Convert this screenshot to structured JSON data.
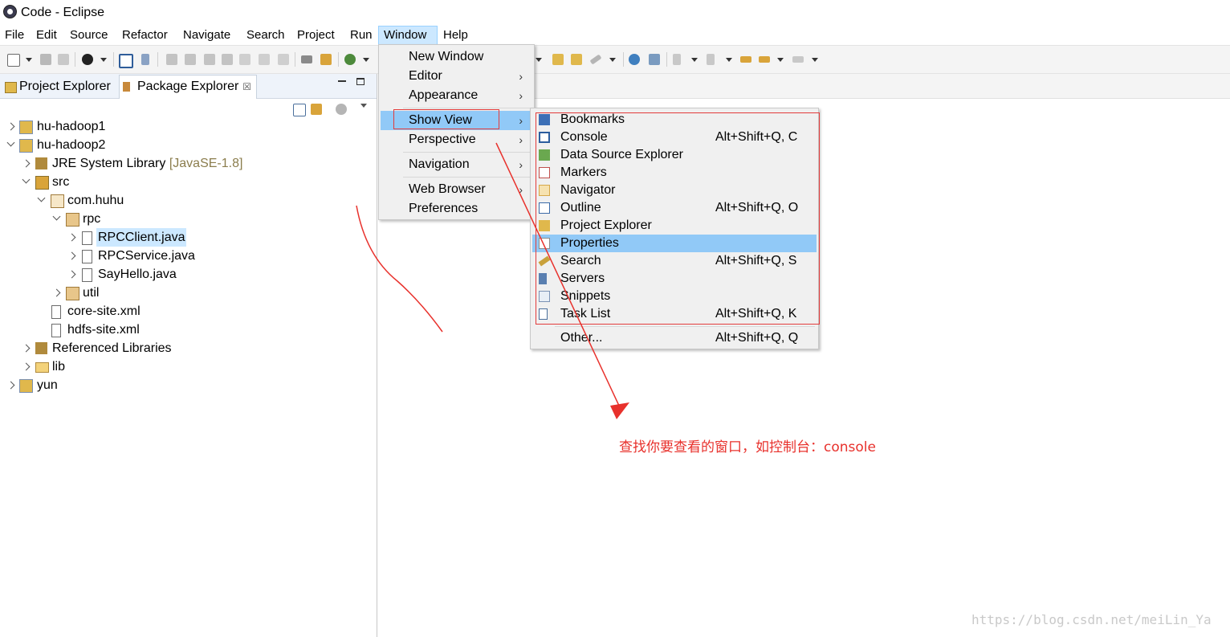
{
  "window": {
    "title": "Code - Eclipse",
    "icon": "eclipse-icon"
  },
  "menubar": {
    "items": [
      {
        "label": "File"
      },
      {
        "label": "Edit"
      },
      {
        "label": "Source"
      },
      {
        "label": "Refactor"
      },
      {
        "label": "Navigate"
      },
      {
        "label": "Search"
      },
      {
        "label": "Project"
      },
      {
        "label": "Run"
      },
      {
        "label": "Window"
      },
      {
        "label": "Help"
      }
    ],
    "active": "Window"
  },
  "left_view": {
    "tabs": [
      {
        "label": "Project Explorer",
        "icon": "project-explorer-icon"
      },
      {
        "label": "Package Explorer",
        "icon": "package-explorer-icon",
        "close": "☒"
      }
    ],
    "tree": [
      {
        "label": "hu-hadoop1",
        "icon": "project-icon"
      },
      {
        "label": "hu-hadoop2",
        "icon": "project-icon"
      },
      {
        "label": "JRE System Library",
        "decoration": "[JavaSE-1.8]",
        "icon": "library-icon"
      },
      {
        "label": "src",
        "icon": "source-folder-icon"
      },
      {
        "label": "com.huhu",
        "icon": "package-icon"
      },
      {
        "label": "rpc",
        "icon": "package-icon"
      },
      {
        "label": "RPCClient.java",
        "icon": "java-file-icon"
      },
      {
        "label": "RPCService.java",
        "icon": "java-file-icon"
      },
      {
        "label": "SayHello.java",
        "icon": "java-file-icon"
      },
      {
        "label": "util",
        "icon": "package-icon"
      },
      {
        "label": "core-site.xml",
        "icon": "xml-file-icon"
      },
      {
        "label": "hdfs-site.xml",
        "icon": "xml-file-icon"
      },
      {
        "label": "Referenced Libraries",
        "icon": "library-icon"
      },
      {
        "label": "lib",
        "icon": "folder-icon"
      },
      {
        "label": "yun",
        "icon": "project-icon"
      }
    ]
  },
  "window_menu": {
    "items": [
      {
        "label": "New Window"
      },
      {
        "label": "Editor",
        "arrow": "›"
      },
      {
        "label": "Appearance",
        "arrow": "›"
      },
      {
        "label": "Show View",
        "arrow": "›"
      },
      {
        "label": "Perspective",
        "arrow": "›"
      },
      {
        "label": "Navigation",
        "arrow": "›"
      },
      {
        "label": "Web Browser",
        "arrow": "›"
      },
      {
        "label": "Preferences"
      }
    ],
    "highlighted": "Show View"
  },
  "show_view_menu": {
    "items": [
      {
        "label": "Bookmarks",
        "shortcut": "",
        "icon": "bookmarks-icon",
        "color": "#3c6fb6"
      },
      {
        "label": "Console",
        "shortcut": "Alt+Shift+Q, C",
        "icon": "console-icon",
        "color": "#2c5d9e"
      },
      {
        "label": "Data Source Explorer",
        "shortcut": "",
        "icon": "data-source-icon",
        "color": "#6aa84f"
      },
      {
        "label": "Markers",
        "shortcut": "",
        "icon": "markers-icon",
        "color": "#c0504d"
      },
      {
        "label": "Navigator",
        "shortcut": "",
        "icon": "navigator-icon",
        "color": "#d6a84a"
      },
      {
        "label": "Outline",
        "shortcut": "Alt+Shift+Q, O",
        "icon": "outline-icon",
        "color": "#3b6aa8"
      },
      {
        "label": "Project Explorer",
        "shortcut": "",
        "icon": "project-explorer-icon",
        "color": "#e0b84c"
      },
      {
        "label": "Properties",
        "shortcut": "",
        "icon": "properties-icon",
        "color": "#8a8a8a"
      },
      {
        "label": "Search",
        "shortcut": "Alt+Shift+Q, S",
        "icon": "search-icon",
        "color": "#c9a13b"
      },
      {
        "label": "Servers",
        "shortcut": "",
        "icon": "servers-icon",
        "color": "#5a7fb0"
      },
      {
        "label": "Snippets",
        "shortcut": "",
        "icon": "snippets-icon",
        "color": "#7c93b5"
      },
      {
        "label": "Task List",
        "shortcut": "Alt+Shift+Q, K",
        "icon": "task-list-icon",
        "color": "#4a6f9c"
      },
      {
        "label": "Other...",
        "shortcut": "Alt+Shift+Q, Q",
        "icon": "",
        "color": ""
      }
    ],
    "highlighted": "Properties"
  },
  "annotation": {
    "text": "查找你要查看的窗口，如控制台：console",
    "color": "#e8312c"
  },
  "watermark": "https://blog.csdn.net/meiLin_Ya"
}
